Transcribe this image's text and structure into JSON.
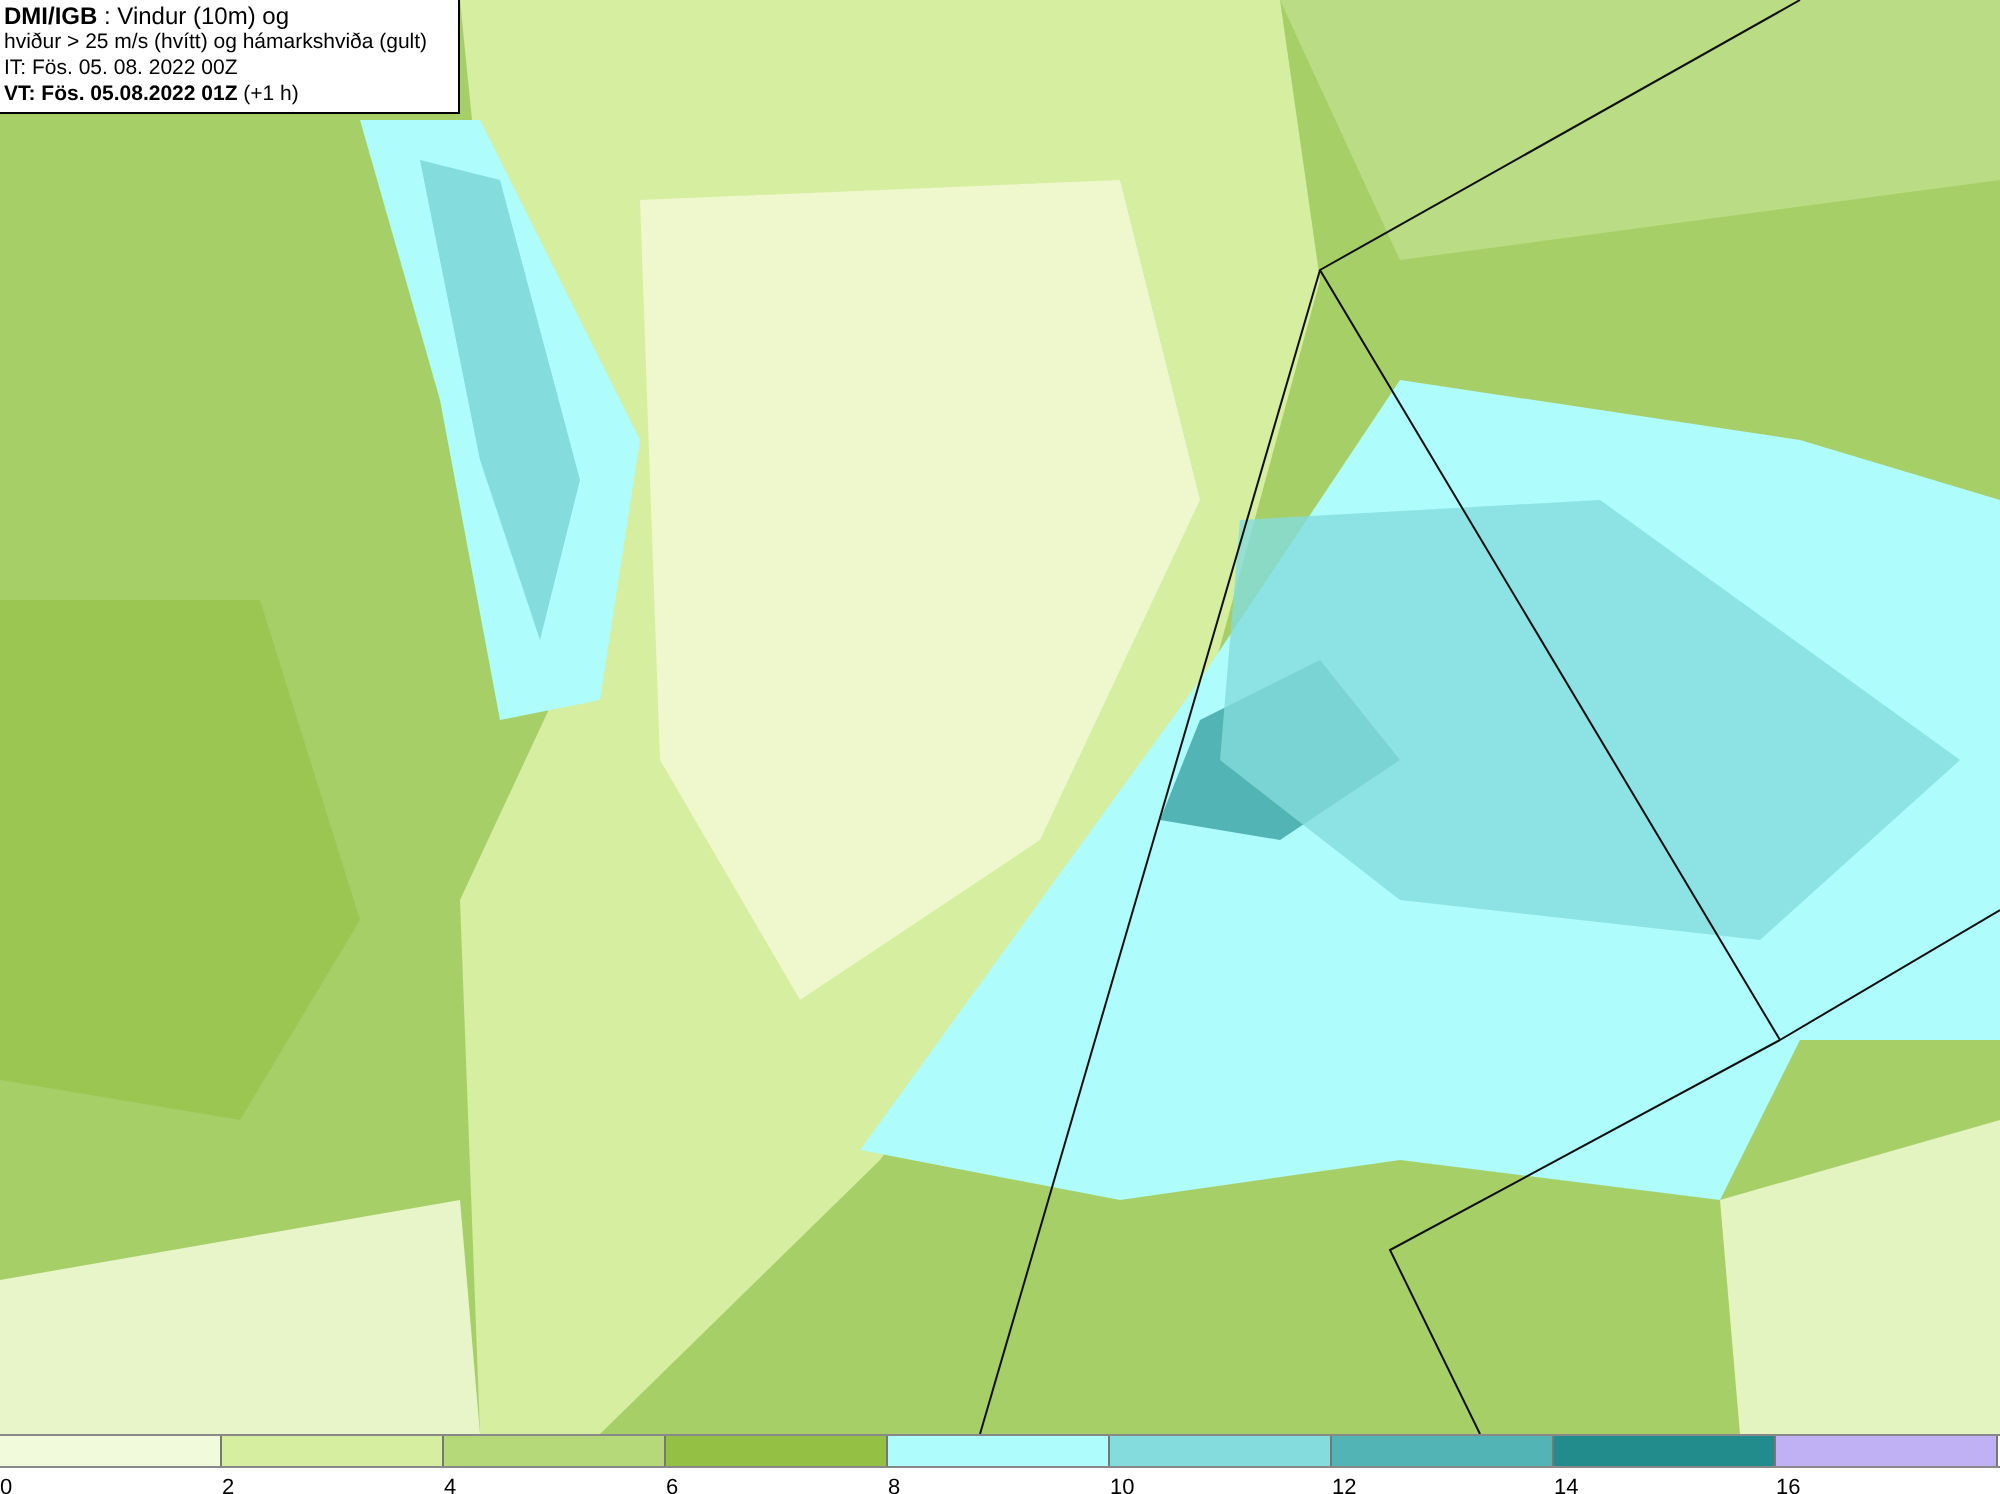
{
  "title_box": {
    "lines": [
      "**DMI/IGB** : Vindur (10m) og",
      "hviður > 25 m/s (hvítt) og hámarkshviða (gult)",
      "IT: Fös. 05. 08. 2022 00Z",
      "**VT: Fös. 05.08.2022 01Z** (+1 h)"
    ]
  },
  "legend": {
    "segments": [
      {
        "color": "#f2fadc",
        "label": "0"
      },
      {
        "color": "#d6eea0",
        "label": "2"
      },
      {
        "color": "#b5d878",
        "label": "4"
      },
      {
        "color": "#94c044",
        "label": "6"
      },
      {
        "color": "#aefcfc",
        "label": "8"
      },
      {
        "color": "#84dcdc",
        "label": "10"
      },
      {
        "color": "#52b4b4",
        "label": "12"
      },
      {
        "color": "#228c8c",
        "label": "14"
      },
      {
        "color": "#c0b0f4",
        "label": "16"
      }
    ]
  }
}
